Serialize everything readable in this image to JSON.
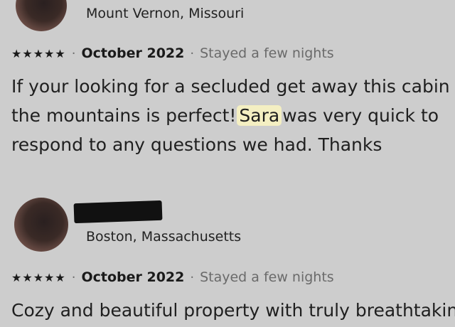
{
  "reviews": [
    {
      "location": "Mount Vernon, Missouri",
      "rating": "★★★★★",
      "date": "October 2022",
      "stay": "Stayed a few nights",
      "text_lines": [
        "If your looking for a secluded get away this cabin in",
        "the mountains  is perfect!",
        "Sara",
        "was very quick to",
        "respond to any questions we had. Thanks"
      ]
    },
    {
      "location": "Boston, Massachusetts",
      "rating": "★★★★★",
      "date": "October 2022",
      "stay": "Stayed a few nights",
      "text_lines": [
        "Cozy and beautiful property with truly breathtaking"
      ]
    }
  ],
  "separator": "·"
}
